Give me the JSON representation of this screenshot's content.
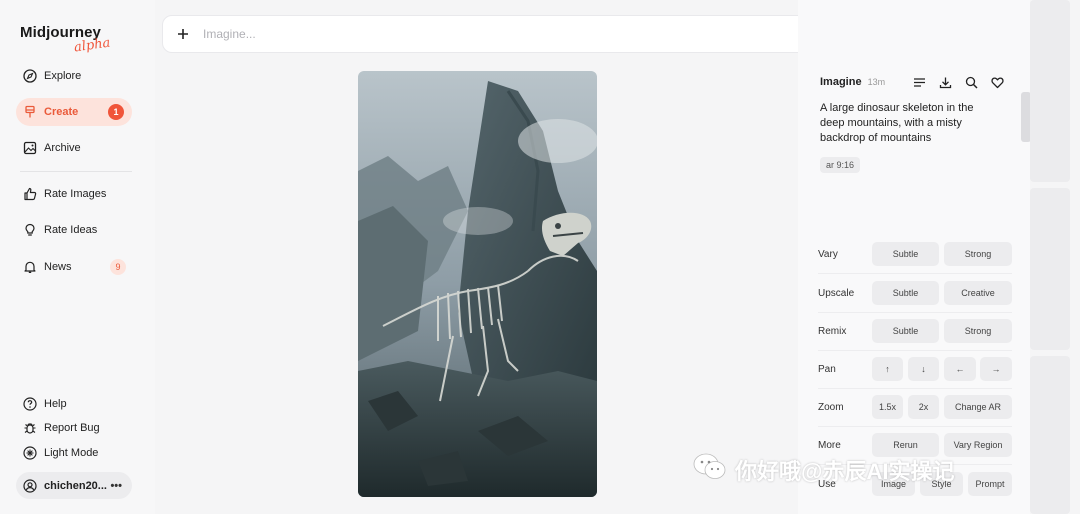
{
  "sidebar": {
    "logo": {
      "name": "Midjourney",
      "tag": "alpha"
    },
    "items": [
      {
        "label": "Explore"
      },
      {
        "label": "Create",
        "badge": "1"
      },
      {
        "label": "Archive"
      },
      {
        "label": "Rate Images"
      },
      {
        "label": "Rate Ideas"
      },
      {
        "label": "News",
        "badge": "9"
      }
    ],
    "bottom": [
      {
        "label": "Help"
      },
      {
        "label": "Report Bug"
      },
      {
        "label": "Light Mode"
      }
    ],
    "user": {
      "name": "chichen20...",
      "menu": "•••"
    }
  },
  "search": {
    "placeholder": "Imagine..."
  },
  "panel": {
    "title": "Imagine",
    "time": "13m",
    "prompt": "A large dinosaur skeleton in the deep mountains, with a misty backdrop of mountains",
    "chip": "ar 9:16",
    "rows": [
      {
        "label": "Vary",
        "buttons": [
          "Subtle",
          "Strong"
        ]
      },
      {
        "label": "Upscale",
        "buttons": [
          "Subtle",
          "Creative"
        ]
      },
      {
        "label": "Remix",
        "buttons": [
          "Subtle",
          "Strong"
        ]
      },
      {
        "label": "Pan",
        "buttons": [
          "↑",
          "↓",
          "←",
          "→"
        ]
      },
      {
        "label": "Zoom",
        "buttons": [
          "1.5x",
          "2x",
          "Change AR"
        ]
      },
      {
        "label": "More",
        "buttons": [
          "Rerun",
          "Vary Region"
        ]
      },
      {
        "label": "Use",
        "buttons": [
          "Image",
          "Style",
          "Prompt"
        ]
      }
    ]
  },
  "watermark": "你好哦@赤辰AI实操记",
  "colors": {
    "accent": "#f0553a",
    "accent_soft": "#fde3dc"
  }
}
